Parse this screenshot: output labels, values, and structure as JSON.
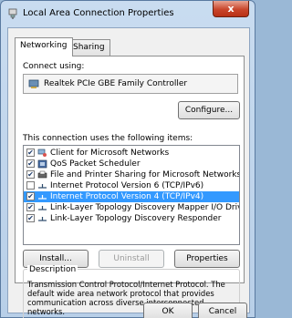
{
  "window": {
    "title": "Local Area Connection Properties",
    "close_glyph": "x"
  },
  "tabs": [
    {
      "label": "Networking"
    },
    {
      "label": "Sharing"
    }
  ],
  "connect_using": {
    "label": "Connect using:",
    "adapter": "Realtek PCIe GBE Family Controller"
  },
  "configure_button": "Configure...",
  "items_label": "This connection uses the following items:",
  "items": [
    {
      "label": "Client for Microsoft Networks",
      "checked": true,
      "icon": "network-client-icon"
    },
    {
      "label": "QoS Packet Scheduler",
      "checked": true,
      "icon": "qos-icon"
    },
    {
      "label": "File and Printer Sharing for Microsoft Networks",
      "checked": true,
      "icon": "file-printer-sharing-icon"
    },
    {
      "label": "Internet Protocol Version 6 (TCP/IPv6)",
      "checked": false,
      "icon": "protocol-icon"
    },
    {
      "label": "Internet Protocol Version 4 (TCP/IPv4)",
      "checked": true,
      "icon": "protocol-icon",
      "selected": true
    },
    {
      "label": "Link-Layer Topology Discovery Mapper I/O Driver",
      "checked": true,
      "icon": "protocol-icon"
    },
    {
      "label": "Link-Layer Topology Discovery Responder",
      "checked": true,
      "icon": "protocol-icon"
    }
  ],
  "buttons": {
    "install": "Install...",
    "uninstall": "Uninstall",
    "properties": "Properties",
    "ok": "OK",
    "cancel": "Cancel"
  },
  "description": {
    "title": "Description",
    "text": "Transmission Control Protocol/Internet Protocol. The default wide area network protocol that provides communication across diverse interconnected networks."
  },
  "colors": {
    "selection": "#3399ff",
    "close": "#c9452b"
  }
}
